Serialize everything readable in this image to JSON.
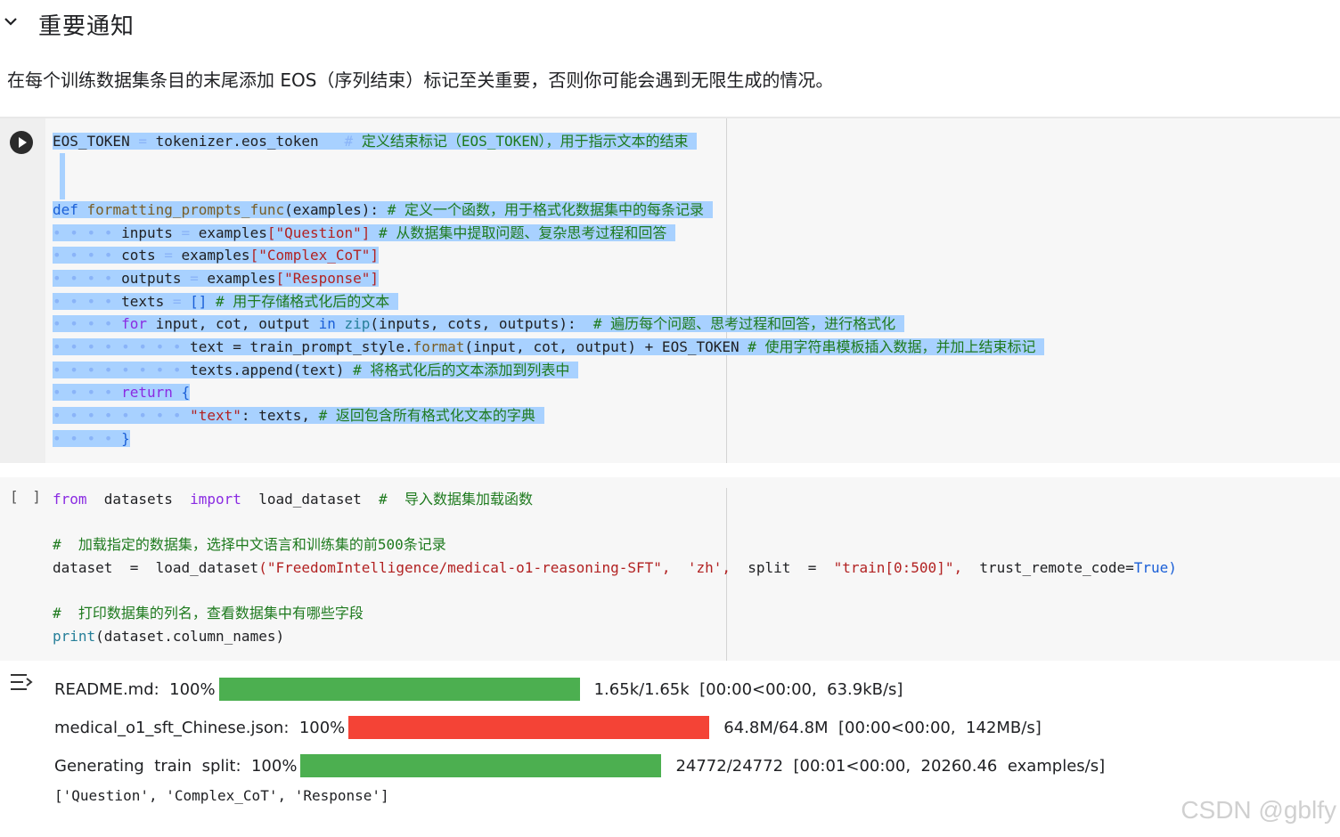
{
  "section": {
    "title": "重要通知",
    "notice": "在每个训练数据集条目的末尾添加 EOS（序列结束）标记至关重要，否则你可能会遇到无限生成的情况。"
  },
  "cell1": {
    "lines": {
      "l1": {
        "a": "EOS_TOKEN",
        "b": " = ",
        "c": "tokenizer.eos_token",
        "d": "   # ",
        "e": "定义结束标记（EOS_TOKEN），用于指示文本的结束 "
      },
      "l3": {
        "kw": "def",
        "fn": " formatting_prompts_func",
        "p": "(examples):",
        "c": " # 定义一个函数，用于格式化数据集中的每条记录 "
      },
      "l4": {
        "a": "inputs",
        "b": " = ",
        "c": "examples",
        "s": "[\"Question\"]",
        "cm": " # 从数据集中提取问题、复杂思考过程和回答 "
      },
      "l5": {
        "a": "cots",
        "b": " = ",
        "c": "examples",
        "s": "[\"Complex_CoT\"]"
      },
      "l6": {
        "a": "outputs",
        "b": " = ",
        "c": "examples",
        "s": "[\"Response\"]"
      },
      "l7": {
        "a": "texts",
        "b": " = ",
        "c": "[]",
        "cm": " # 用于存储格式化后的文本 "
      },
      "l8": {
        "kw": "for",
        "a": " input, cot, output ",
        "kw2": "in",
        "bi": " zip",
        "c": "(inputs, cots, outputs):",
        "cm": "  # 遍历每个问题、思考过程和回答，进行格式化 "
      },
      "l9": {
        "a": "text = train_prompt_style.",
        "fn": "format",
        "c": "(input, cot, output)",
        "d": " + EOS_TOKEN",
        "cm": " # 使用字符串模板插入数据，并加上结束标记 "
      },
      "l10": {
        "a": "texts.append(text)",
        "cm": " # 将格式化后的文本添加到列表中 "
      },
      "l11": {
        "kw": "return",
        "a": " {"
      },
      "l12": {
        "s": "\"text\"",
        "a": ": texts,",
        "cm": " # 返回包含所有格式化文本的字典 "
      },
      "l13": {
        "a": "}"
      }
    }
  },
  "cell2": {
    "exec_count": "[ ]",
    "l1": {
      "kw": "from",
      "a": "  datasets  ",
      "kw2": "import",
      "b": "  load_dataset  ",
      "cm": "#  导入数据集加载函数"
    },
    "l3": {
      "cm": "#  加载指定的数据集，选择中文语言和训练集的前500条记录"
    },
    "l4": {
      "a": "dataset  =  load_dataset",
      "s1": "(\"FreedomIntelligence/medical-o1-reasoning-SFT\",",
      "b": "  ",
      "s2": "'zh',",
      "c": "  split  =  ",
      "s3": "\"train[0:500]\",",
      "d": "  trust_remote_code=",
      "kw": "True",
      "e": ")"
    },
    "l6": {
      "cm": "#  打印数据集的列名，查看数据集中有哪些字段"
    },
    "l7": {
      "bi": "print",
      "a": "(dataset.column_names)"
    }
  },
  "output": {
    "rows": [
      {
        "label": "README.md:  100%",
        "stats": "1.65k/1.65k  [00:00<00:00,  63.9kB/s]",
        "progress": 1.0,
        "color": "#4caf50"
      },
      {
        "label": "medical_o1_sft_Chinese.json:  100%",
        "stats": "64.8M/64.8M  [00:00<00:00,  142MB/s]",
        "progress": 1.0,
        "color": "#f44336"
      },
      {
        "label": "Generating  train  split:  100%",
        "stats": "24772/24772  [00:01<00:00,  20260.46  examples/s]",
        "progress": 1.0,
        "color": "#4caf50"
      }
    ],
    "result": "['Question', 'Complex_CoT', 'Response']"
  },
  "watermark": "CSDN @gblfy"
}
